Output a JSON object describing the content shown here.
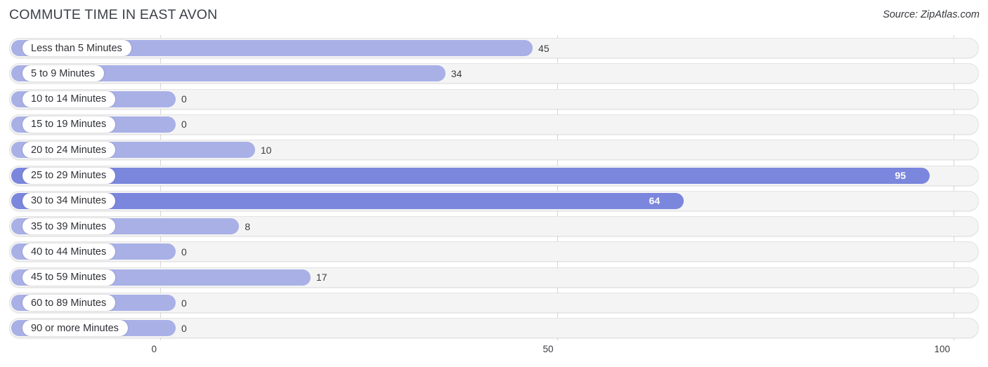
{
  "header": {
    "title": "COMMUTE TIME IN EAST AVON",
    "source": "Source: ZipAtlas.com"
  },
  "chart_data": {
    "type": "bar",
    "orientation": "horizontal",
    "title": "COMMUTE TIME IN EAST AVON",
    "subtitle": "Source: ZipAtlas.com",
    "xlabel": "",
    "ylabel": "",
    "xlim": [
      0,
      100
    ],
    "xticks": [
      0,
      50,
      100
    ],
    "xtick_labels": [
      "0",
      "50",
      "100"
    ],
    "grid": true,
    "legend": false,
    "categories": [
      "Less than 5 Minutes",
      "5 to 9 Minutes",
      "10 to 14 Minutes",
      "15 to 19 Minutes",
      "20 to 24 Minutes",
      "25 to 29 Minutes",
      "30 to 34 Minutes",
      "35 to 39 Minutes",
      "40 to 44 Minutes",
      "45 to 59 Minutes",
      "60 to 89 Minutes",
      "90 or more Minutes"
    ],
    "values": [
      45,
      34,
      0,
      0,
      10,
      95,
      64,
      8,
      0,
      17,
      0,
      0
    ],
    "value_labels": [
      "45",
      "34",
      "0",
      "0",
      "10",
      "95",
      "64",
      "8",
      "0",
      "17",
      "0",
      "0"
    ],
    "colors": {
      "bar_light": "#a8b0e6",
      "bar_strong": "#7b86dd",
      "track": "#f4f4f4",
      "track_border": "#e3e3e3",
      "gridline": "#d6d6d6",
      "label_pill": "#ffffff",
      "text": "#3a3c40"
    }
  }
}
